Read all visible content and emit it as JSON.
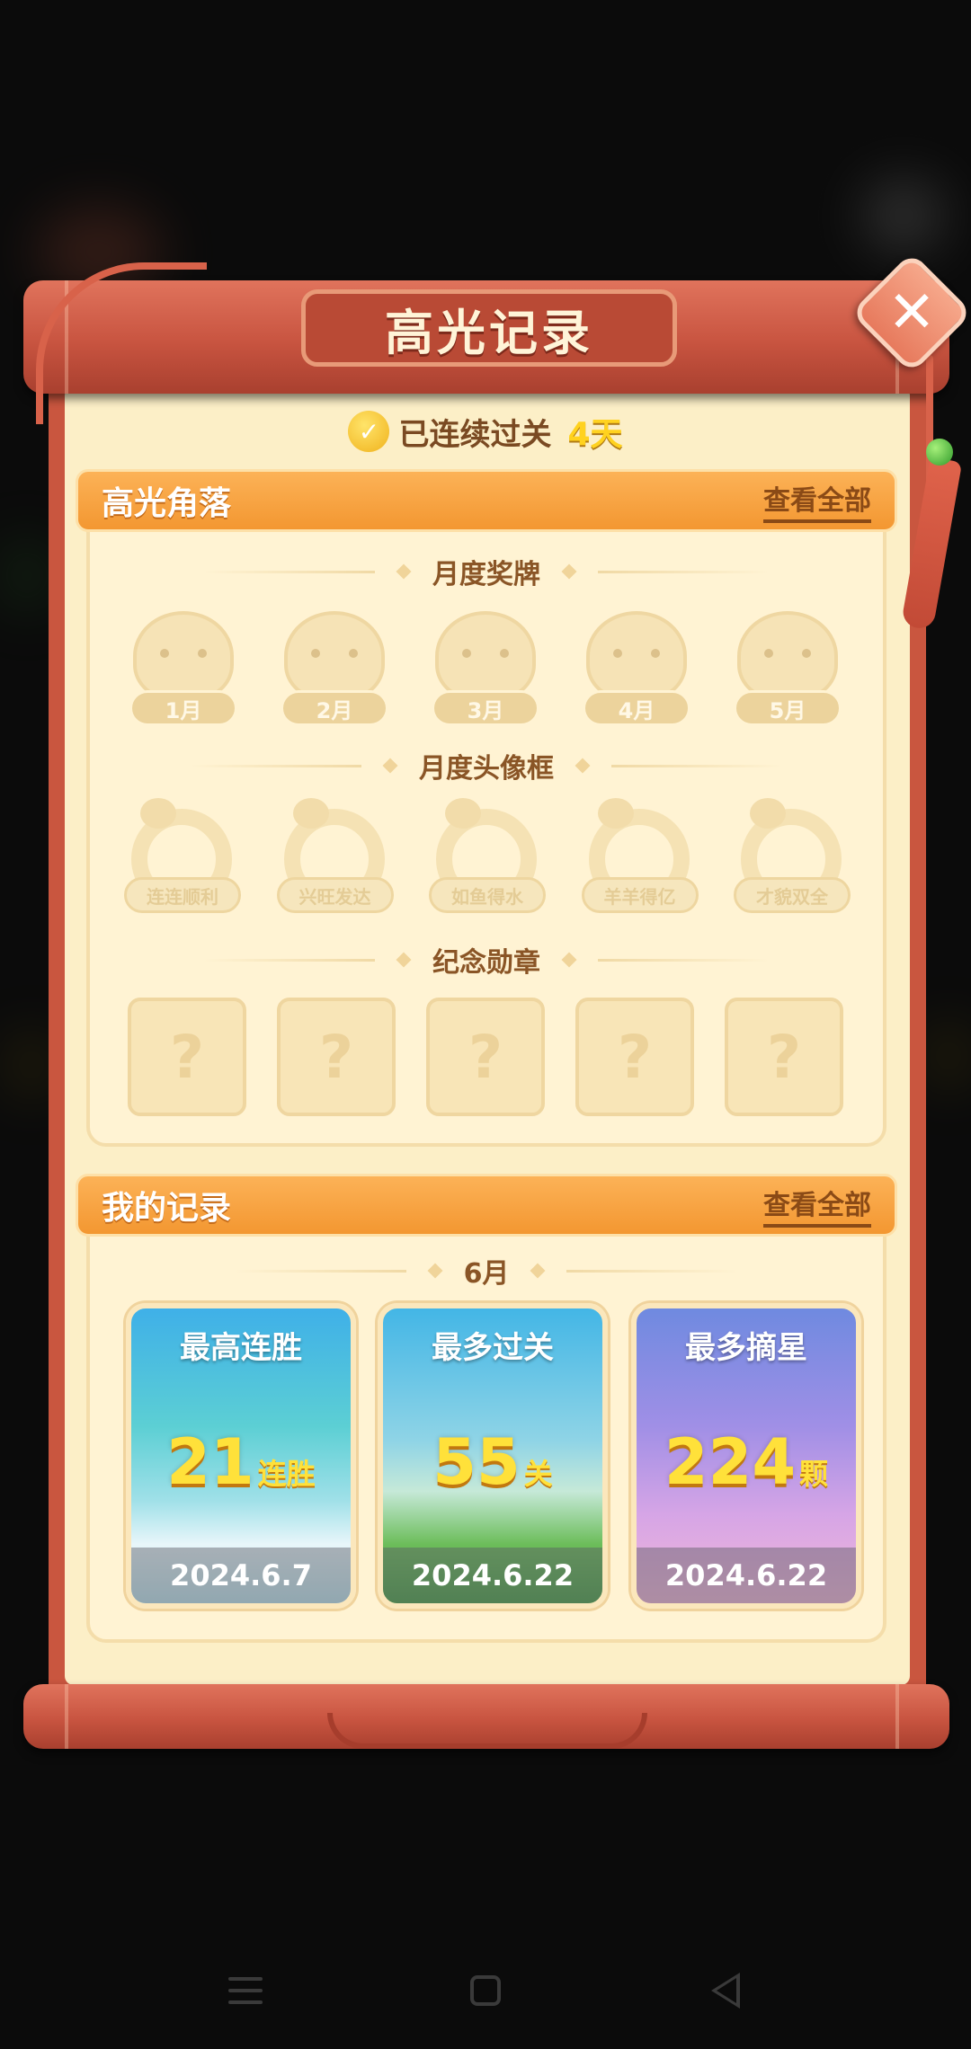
{
  "window": {
    "title": "高光记录"
  },
  "streak": {
    "text": "已连续过关",
    "value": "4天",
    "icon": "check-coin-icon"
  },
  "highlight": {
    "title": "高光角落",
    "view_all": "查看全部",
    "medals": {
      "title": "月度奖牌",
      "items": [
        "1月",
        "2月",
        "3月",
        "4月",
        "5月"
      ]
    },
    "frames": {
      "title": "月度头像框",
      "items": [
        "连连顺利",
        "兴旺发达",
        "如鱼得水",
        "羊羊得亿",
        "才貌双全"
      ]
    },
    "badges": {
      "title": "纪念勋章",
      "items": [
        "?",
        "?",
        "?",
        "?",
        "?"
      ]
    }
  },
  "records": {
    "title": "我的记录",
    "view_all": "查看全部",
    "month": "6月",
    "cards": [
      {
        "name": "最高连胜",
        "value": "21",
        "unit": "连胜",
        "date": "2024.6.7"
      },
      {
        "name": "最多过关",
        "value": "55",
        "unit": "关",
        "date": "2024.6.22"
      },
      {
        "name": "最多摘星",
        "value": "224",
        "unit": "颗",
        "date": "2024.6.22"
      }
    ]
  },
  "icons": {
    "close": "close-icon",
    "menu": "menu-icon",
    "home": "home-icon",
    "back": "back-icon"
  },
  "colors": {
    "accent": "#f39731",
    "scroll": "#c9563f",
    "paper": "#fcefc7",
    "highlight_text": "#ffe13a"
  }
}
